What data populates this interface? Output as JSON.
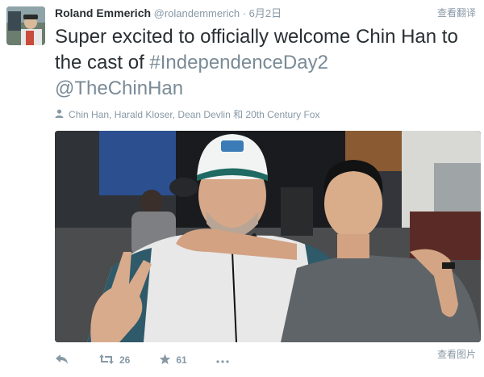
{
  "tweet": {
    "author_name": "Roland Emmerich",
    "author_handle": "@rolandemmerich",
    "separator": "·",
    "date": "6月2日",
    "translate_label": "查看翻译",
    "text_plain_1": "Super excited to officially welcome Chin Han to the cast of ",
    "hashtag": "#IndependenceDay2",
    "mention": "@TheChinHan",
    "tagged_people": "Chin Han, Harald Kloser, Dean Devlin 和 20th Century Fox",
    "view_photo_label": "查看图片"
  },
  "actions": {
    "reply_icon": "reply-icon",
    "retweet_count": "26",
    "favorite_count": "61",
    "more_icon": "more-icon"
  },
  "colors": {
    "text": "#292f33",
    "muted": "#8899a6",
    "link": "#7a8b97"
  }
}
